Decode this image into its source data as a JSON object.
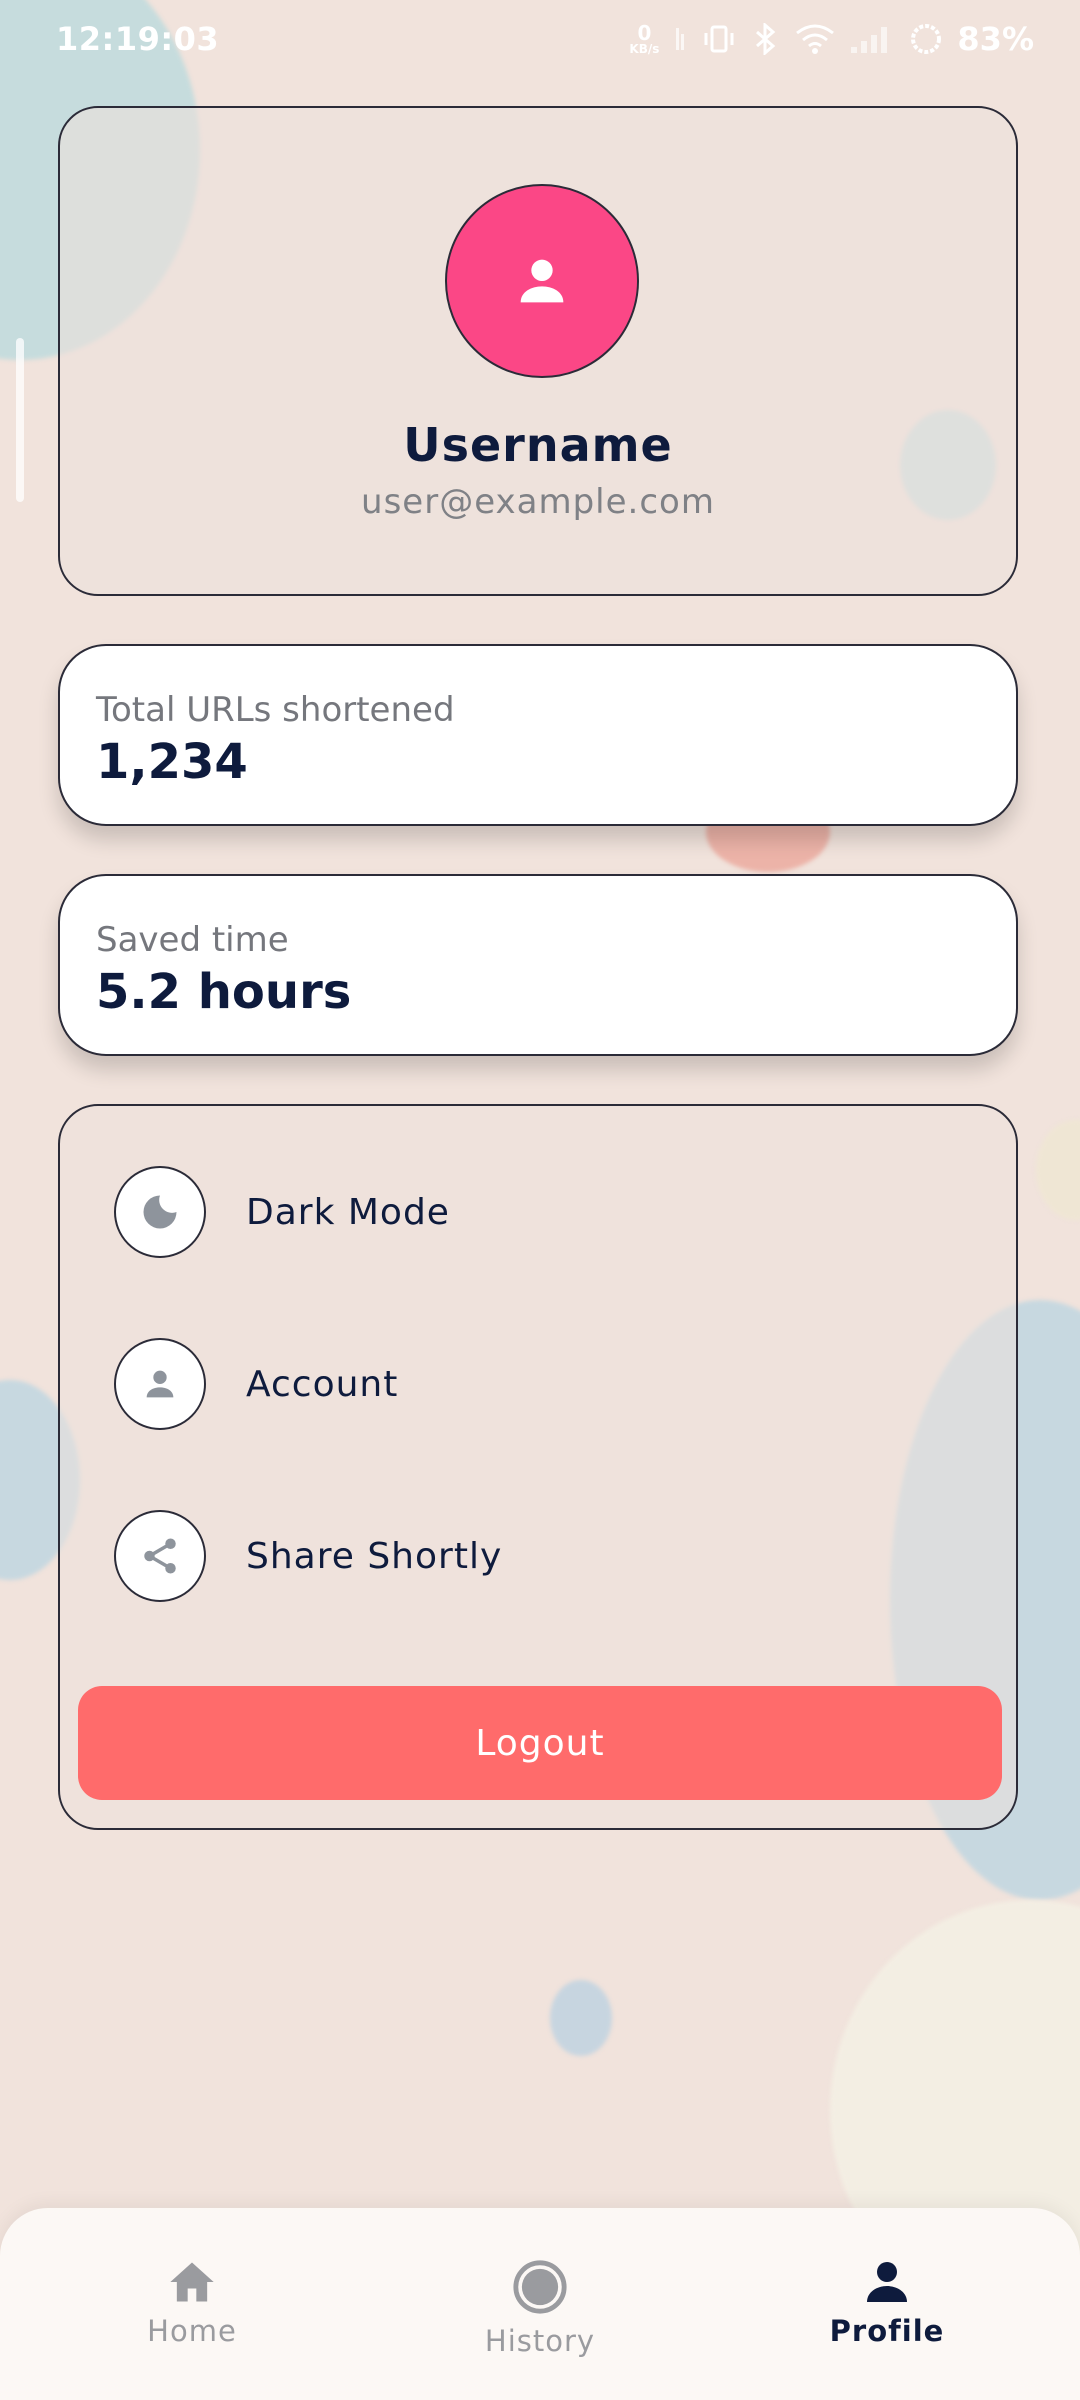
{
  "status_bar": {
    "time": "12:19:03",
    "net_speed_value": "0",
    "net_speed_unit": "KB/s",
    "battery": "83%"
  },
  "profile": {
    "username": "Username",
    "email": "user@example.com"
  },
  "stats": [
    {
      "label": "Total URLs shortened",
      "value": "1,234"
    },
    {
      "label": "Saved time",
      "value": "5.2 hours"
    }
  ],
  "settings": {
    "items": [
      {
        "label": "Dark Mode",
        "icon": "moon-icon"
      },
      {
        "label": "Account",
        "icon": "person-icon"
      },
      {
        "label": "Share Shortly",
        "icon": "share-icon"
      }
    ],
    "logout_label": "Logout"
  },
  "bottom_nav": {
    "items": [
      {
        "label": "Home",
        "icon": "home-icon",
        "active": false
      },
      {
        "label": "History",
        "icon": "history-icon",
        "active": false
      },
      {
        "label": "Profile",
        "icon": "profile-icon",
        "active": true
      }
    ]
  },
  "colors": {
    "background": "#f1e3dc",
    "accent_pink": "#fb4786",
    "logout_red": "#ff6b6b",
    "text_navy": "#0e1b3d"
  }
}
